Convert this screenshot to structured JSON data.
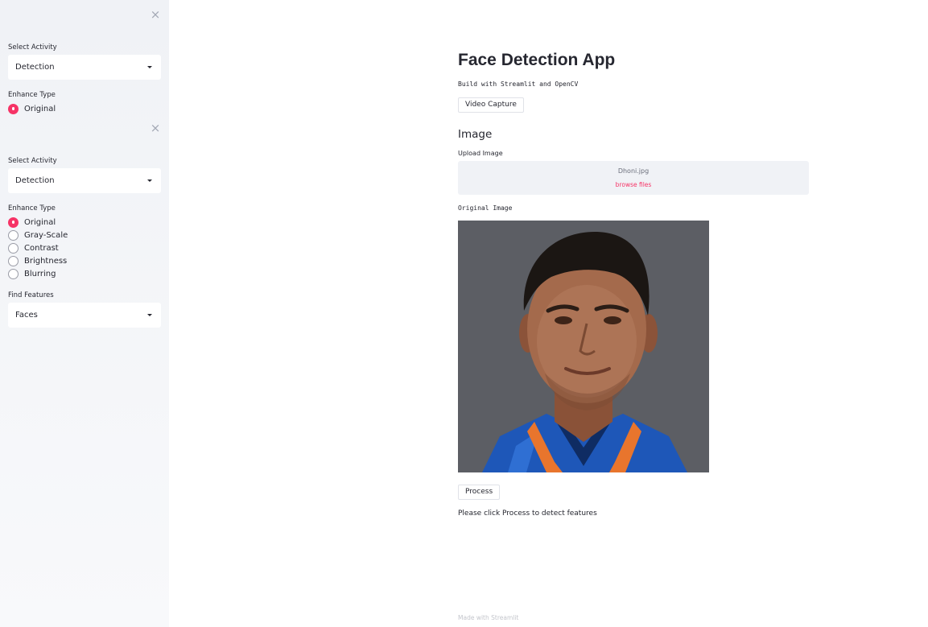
{
  "sidebar": {
    "group1": {
      "close_icon": "×",
      "activity_label": "Select Activity",
      "activity_value": "Detection",
      "enhance_label": "Enhance Type",
      "options": [
        {
          "label": "Original",
          "selected": true
        }
      ]
    },
    "group2": {
      "close_icon": "×",
      "activity_label": "Select Activity",
      "activity_value": "Detection",
      "enhance_label": "Enhance Type",
      "options": [
        {
          "label": "Original",
          "selected": true
        },
        {
          "label": "Gray-Scale",
          "selected": false
        },
        {
          "label": "Contrast",
          "selected": false
        },
        {
          "label": "Brightness",
          "selected": false
        },
        {
          "label": "Blurring",
          "selected": false
        }
      ],
      "features_label": "Find Features",
      "features_value": "Faces"
    }
  },
  "main": {
    "title": "Face Detection App",
    "subtitle": "Build with Streamlit and OpenCV",
    "video_button": "Video Capture",
    "image_header": "Image",
    "upload_label": "Upload Image",
    "upload_filename": "Dhoni.jpg",
    "upload_browse": "browse files",
    "original_label": "Original Image",
    "process_button": "Process",
    "hint": "Please click Process to detect features",
    "footer": "Made with Streamlit"
  },
  "colors": {
    "accent": "#f63366",
    "sidebar_bg": "#f0f2f6",
    "text": "#262730"
  }
}
